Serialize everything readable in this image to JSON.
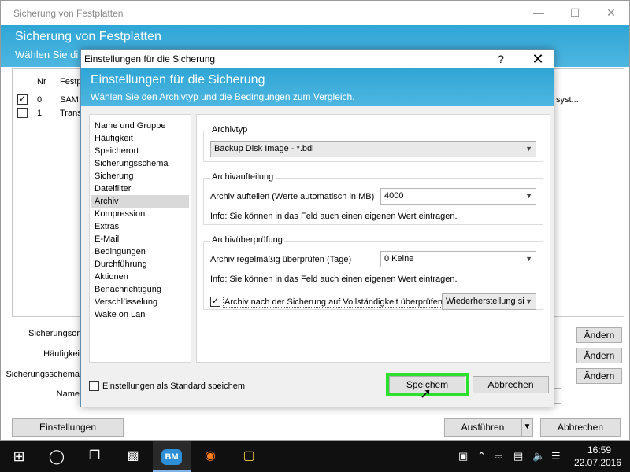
{
  "main": {
    "title": "Sicherung von Festplatten",
    "header_title": "Sicherung von Festplatten",
    "header_subtitle": "Wählen Sie di",
    "columns": {
      "nr": "Nr",
      "festp": "Festp"
    },
    "rows": [
      {
        "checked": true,
        "nr": "0",
        "name": "SAMS",
        "extra": "syst..."
      },
      {
        "checked": false,
        "nr": "1",
        "name": "Trans",
        "extra": ""
      }
    ],
    "labels": {
      "sicherungsort": "Sicherungsor",
      "haeufigkeit": "Häufigkei",
      "sicherungsschema": "Sicherungsschema",
      "name": "Name"
    },
    "aendern_label": "Ändern",
    "einstellungen_label": "Einstellungen",
    "ausfuehren_label": "Ausführen",
    "abbrechen_label": "Abbrechen"
  },
  "dialog": {
    "title": "Einstellungen für die Sicherung",
    "help": "?",
    "header_title": "Einstellungen für die Sicherung",
    "header_subtitle": "Wählen Sie den Archivtyp und die Bedingungen zum Vergleich.",
    "nav_items": [
      "Name und Gruppe",
      "Häufigkeit",
      "Speicherort",
      "Sicherungsschema",
      "Sicherung",
      "Dateifilter",
      "Archiv",
      "Kompression",
      "Extras",
      "E-Mail",
      "Bedingungen",
      "Durchführung",
      "Aktionen",
      "Benachrichtigung",
      "Verschlüsselung",
      "Wake on Lan"
    ],
    "selected_nav_index": 6,
    "archivtyp": {
      "legend": "Archivtyp",
      "value": "Backup Disk Image - *.bdi"
    },
    "archivaufteilung": {
      "legend": "Archivaufteilung",
      "label": "Archiv aufteilen (Werte automatisch in MB)",
      "value": "4000",
      "info": "Info: Sie können in das Feld auch einen eigenen Wert eintragen."
    },
    "archivpruefung": {
      "legend": "Archivüberprüfung",
      "label": "Archiv regelmäßig überprüfen (Tage)",
      "value": "0 Keine",
      "info": "Info: Sie können in das Feld auch einen eigenen Wert eintragen.",
      "check_label": "Archiv nach der Sicherung auf Vollständigkeit überprüfen",
      "check_value": true,
      "restore_value": "Wiederherstellung si"
    },
    "standard_label": "Einstellungen als Standard speichem",
    "save_label": "Speichem",
    "cancel_label": "Abbrechen"
  },
  "taskbar": {
    "time": "16:59",
    "date": "22.07.2016"
  },
  "colors": {
    "header_blue": "#2fa6d6",
    "highlight_green": "#2de02d"
  }
}
